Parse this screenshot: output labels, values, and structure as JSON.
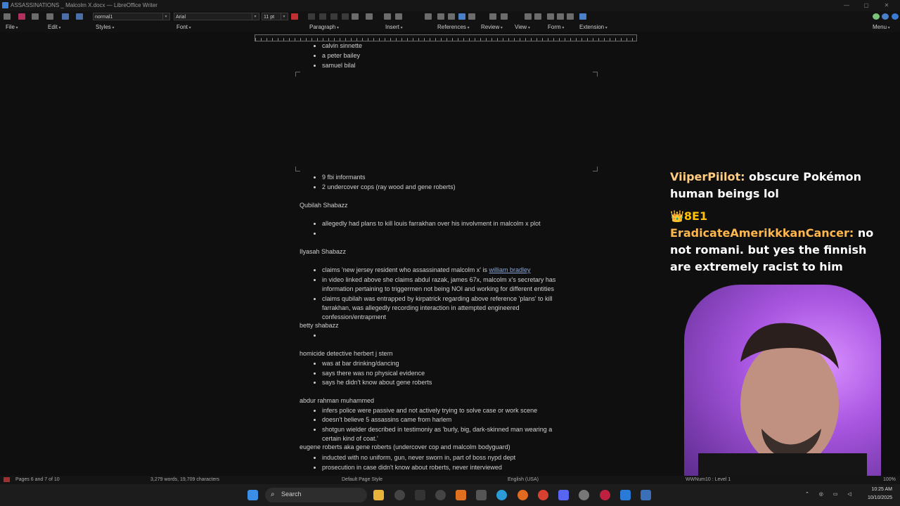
{
  "window": {
    "title": "ASSASSINATIONS _ Malcolm X.docx — LibreOffice Writer",
    "controls": [
      "—",
      "▢",
      "✕"
    ]
  },
  "toolbar": {
    "paragraph_style": "normal1",
    "font_name": "Arial",
    "font_size": "11 pt"
  },
  "menubar": {
    "left": [
      "File",
      "Edit",
      "Styles",
      "Font",
      "Paragraph",
      "Insert",
      "References",
      "Review",
      "View",
      "Form",
      "Extension"
    ],
    "right": "Menu"
  },
  "document": {
    "sections": [
      {
        "bullets": [
          "calvin sinnette",
          "a peter bailey",
          "samuel bilal"
        ]
      },
      {
        "bullets": [
          "9 fbi informants",
          "2 undercover cops (ray wood and gene roberts)"
        ]
      },
      {
        "heading": "Qubilah Shabazz",
        "bullets": [
          "allegedly had plans to kill louis farrakhan over his involvment in malcolm x plot",
          ""
        ]
      },
      {
        "heading": "Ilyasah Shabazz",
        "bullets": [
          [
            "claims 'new jersey resident who assassinated malcolm x' is ",
            "william bradley"
          ],
          [
            "in video linked above she claims abdul razak, james 67x, malcolm x's secretary has",
            "information pertaining to triggermen not being NOI and working for different entities"
          ],
          [
            "claims qubilah was entrapped by kirpatrick regarding above reference 'plans' to kill",
            "farrakhan, was allegedly recording interaction in attempted engineered",
            "confession/entrapment"
          ]
        ]
      },
      {
        "heading": "betty shabazz",
        "bullets": [
          ""
        ]
      },
      {
        "heading": "homicide detective herbert j stern",
        "bullets": [
          "was at bar drinking/dancing",
          "says there was no physical evidence",
          "says he didn't know about gene roberts"
        ]
      },
      {
        "heading": "abdur rahman muhammed",
        "bullets": [
          [
            "infers police were passive and not actively trying to solve case or work scene"
          ],
          [
            "doesn't believe 5 assassins came from harlem"
          ],
          [
            "shotgun wielder described in testimoniy as 'burly, big, dark-skinned man wearing a",
            "certain kind of coat.'"
          ]
        ]
      },
      {
        "heading": "eugene roberts aka gene roberts (undercover cop and malcolm bodyguard)",
        "bullets": [
          "inducted with no uniform, gun, never sworn in, part of boss nypd dept",
          "prosecution in case didn't know about roberts, never interviewed"
        ]
      }
    ]
  },
  "chat": [
    {
      "user": "ViiperPiilot:",
      "message": " obscure Pokémon human beings lol"
    },
    {
      "badges": "👑8E1",
      "user": "EradicateAmerikkkanCancer:",
      "message": " no not romani. but yes the finnish are extremely racist to him"
    }
  ],
  "statusbar": {
    "pages": "Pages 6 and 7 of 10",
    "words": "3,279 words, 19,709 characters",
    "page_style": "Default Page Style",
    "language": "English (USA)",
    "list_level": "WWNum10 : Level 1",
    "zoom": "100%"
  },
  "taskbar": {
    "search_placeholder": "Search",
    "time": "10:25 AM",
    "date": "10/10/2025"
  }
}
